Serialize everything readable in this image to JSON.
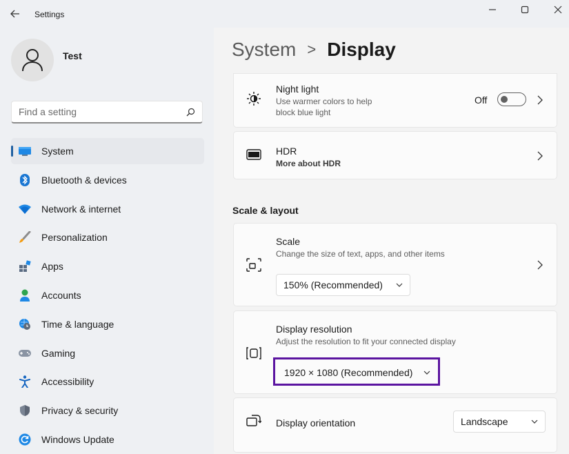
{
  "window": {
    "title": "Settings"
  },
  "user": {
    "name": "Test"
  },
  "search": {
    "placeholder": "Find a setting"
  },
  "nav": {
    "items": [
      {
        "label": "System",
        "icon": "monitor-icon",
        "active": true
      },
      {
        "label": "Bluetooth & devices",
        "icon": "bluetooth-icon"
      },
      {
        "label": "Network & internet",
        "icon": "wifi-icon"
      },
      {
        "label": "Personalization",
        "icon": "brush-icon"
      },
      {
        "label": "Apps",
        "icon": "apps-icon"
      },
      {
        "label": "Accounts",
        "icon": "person-icon"
      },
      {
        "label": "Time & language",
        "icon": "globe-clock-icon"
      },
      {
        "label": "Gaming",
        "icon": "gamepad-icon"
      },
      {
        "label": "Accessibility",
        "icon": "accessibility-icon"
      },
      {
        "label": "Privacy & security",
        "icon": "shield-icon"
      },
      {
        "label": "Windows Update",
        "icon": "update-icon"
      }
    ]
  },
  "breadcrumb": {
    "parent": "System",
    "separator": ">",
    "current": "Display"
  },
  "night_light": {
    "title": "Night light",
    "subtitle": "Use warmer colors to help block blue light",
    "state": "Off"
  },
  "hdr": {
    "title": "HDR",
    "subtitle": "More about HDR"
  },
  "scale_layout": {
    "heading": "Scale & layout",
    "scale": {
      "title": "Scale",
      "subtitle": "Change the size of text, apps, and other items",
      "value": "150% (Recommended)"
    },
    "resolution": {
      "title": "Display resolution",
      "subtitle": "Adjust the resolution to fit your connected display",
      "value": "1920 × 1080 (Recommended)"
    },
    "orientation": {
      "title": "Display orientation",
      "value": "Landscape"
    }
  },
  "colors": {
    "accent": "#1f5fa0",
    "highlight": "#5b14a0",
    "sidebar_bg": "#eef0f3",
    "card_bg": "#fbfbfb"
  }
}
